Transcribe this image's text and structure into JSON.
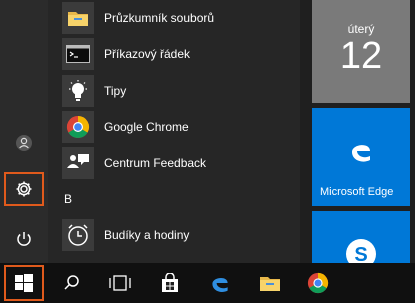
{
  "apps": [
    {
      "label": "Průzkumník souborů",
      "icon": "file-explorer-icon"
    },
    {
      "label": "Příkazový řádek",
      "icon": "command-prompt-icon"
    },
    {
      "label": "Tipy",
      "icon": "lightbulb-icon"
    },
    {
      "label": "Google Chrome",
      "icon": "chrome-icon"
    },
    {
      "label": "Centrum Feedback",
      "icon": "feedback-hub-icon"
    }
  ],
  "section_b": {
    "letter": "B",
    "apps": [
      {
        "label": "Budíky a hodiny",
        "icon": "alarm-clock-icon"
      }
    ]
  },
  "tiles": {
    "calendar": {
      "day_name": "úterý",
      "day_number": "12"
    },
    "edge": {
      "label": "Microsoft Edge"
    }
  },
  "rail": {
    "items": [
      "user-icon",
      "settings-icon",
      "power-icon"
    ]
  },
  "taskbar": {
    "items": [
      "start-icon",
      "search-icon",
      "task-view-icon",
      "store-icon",
      "edge-icon",
      "file-explorer-icon",
      "chrome-icon"
    ]
  },
  "colors": {
    "accent": "#0078d7",
    "highlight": "#e05a1c",
    "calendar_tile": "#7a7a7a"
  }
}
